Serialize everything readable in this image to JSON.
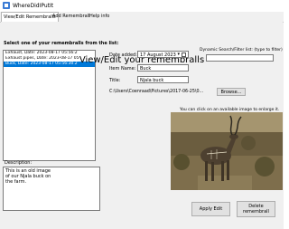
{
  "window": {
    "title": "WhereDidIPutIt"
  },
  "tabs": [
    {
      "label": "View/Edit Remembralls",
      "active": true
    },
    {
      "label": "Add Remembrall",
      "active": false
    },
    {
      "label": "Help info",
      "active": false
    }
  ],
  "main": {
    "heading": "View/Edit your remembralls",
    "list_prompt": "Select one of your remembralls from the list:",
    "list_items": [
      {
        "text": "Exhaust, Date: 2023-08-17 05:56:2",
        "selected": false
      },
      {
        "text": "Exhaust pipes, Date: 2023-08-17 05",
        "selected": false
      },
      {
        "text": "Buck, Date: 2023-08-17 05:56:30.2",
        "selected": true
      }
    ],
    "search_label": "Dynamic Search/Filter list: (type to filter)",
    "search_value": "",
    "date_label": "Date added:",
    "date_value": "17   August   2023",
    "item_name_label": "Item Name:",
    "item_name_value": "Buck",
    "title_label": "Title:",
    "title_value": "Njala buck",
    "file_path": "C:\\Users\\Coenraad\\Pictures\\2017-06-25\\0...",
    "browse_label": "Browse...",
    "image_hint": "You can click on an available image to enlarge it.",
    "description_label": "Description:",
    "description_value": "This is an old image\nof our Njala buck on\nthe farm.",
    "apply_label": "Apply Edit",
    "delete_label": "Delete\nremembrall"
  },
  "colors": {
    "selection": "#0078d7",
    "window_bg": "#f0f0f0"
  },
  "icons": {
    "app": "app-icon",
    "calendar": "calendar-icon"
  }
}
